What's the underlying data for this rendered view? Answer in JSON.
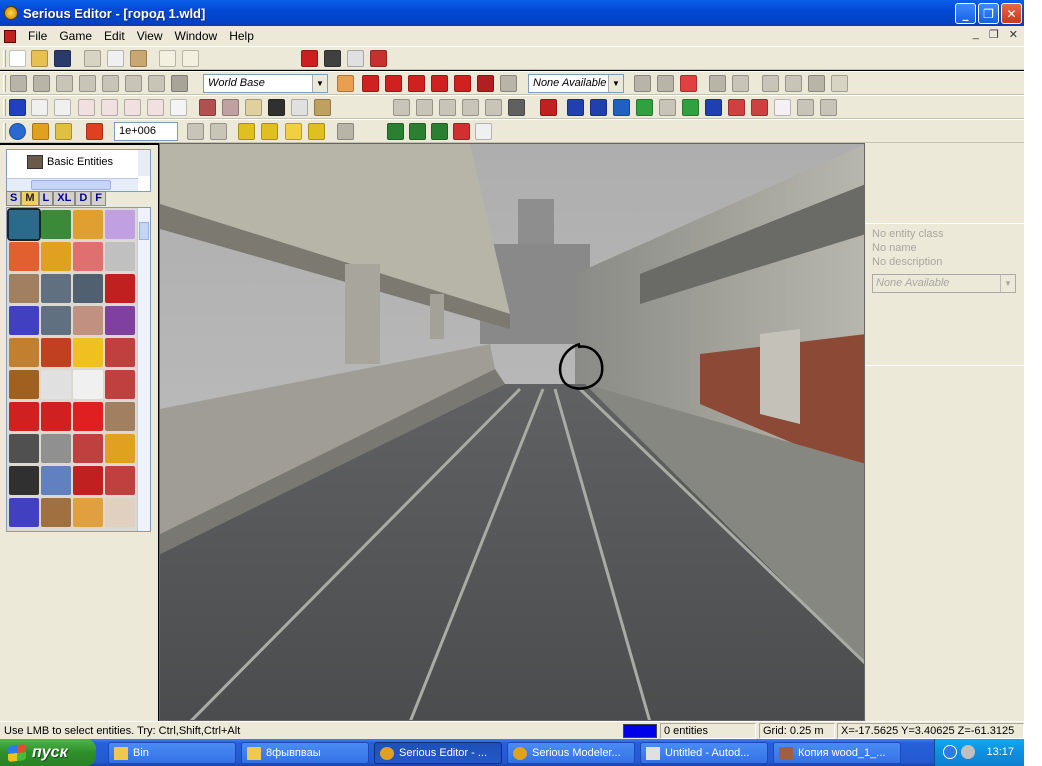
{
  "window": {
    "title": "Serious Editor - [город 1.wld]"
  },
  "title_buttons": {
    "minimize": "_",
    "maximize": "❐",
    "close": "✕"
  },
  "menu": {
    "items": [
      "File",
      "Game",
      "Edit",
      "View",
      "Window",
      "Help"
    ],
    "mdi_controls": [
      "_",
      "❐",
      "✕"
    ]
  },
  "toolbar": {
    "world_base_combo": "World Base",
    "none_available_combo": "None Available",
    "zoom_value": "1e+006",
    "dropdown_arrow": "▼"
  },
  "left_panel": {
    "tree_item": "Basic Entities",
    "size_tabs": [
      "S",
      "M",
      "L",
      "XL",
      "D",
      "F"
    ],
    "active_tab": "M"
  },
  "right_panel": {
    "entity_class": "No entity class",
    "entity_name": "No name",
    "entity_description": "No description",
    "property_combo": "None Available"
  },
  "status_bar": {
    "hint": "Use LMB to select entities. Try: Ctrl,Shift,Ctrl+Alt",
    "entities": "0 entities",
    "grid": "Grid: 0.25 m",
    "coords": "X=-17.5625 Y=3.40625 Z=-61.3125",
    "color_swatch": "#0000e8"
  },
  "taskbar": {
    "start": "пуск",
    "tasks": [
      {
        "label": "Bin",
        "icon": "folder-icon"
      },
      {
        "label": "8фывпваы",
        "icon": "folder-icon"
      },
      {
        "label": "Serious Editor - ...",
        "icon": "serious-editor-icon"
      },
      {
        "label": "Serious Modeler...",
        "icon": "serious-modeler-icon"
      },
      {
        "label": "Untitled - Autod...",
        "icon": "autodesk-icon"
      },
      {
        "label": "Копия wood_1_...",
        "icon": "image-icon"
      }
    ],
    "clock": "13:17"
  },
  "colors": {
    "titlebar": "#0348d3",
    "chrome": "#ece9d8",
    "taskbar": "#2459d0",
    "start_button": "#2e8f2a"
  }
}
